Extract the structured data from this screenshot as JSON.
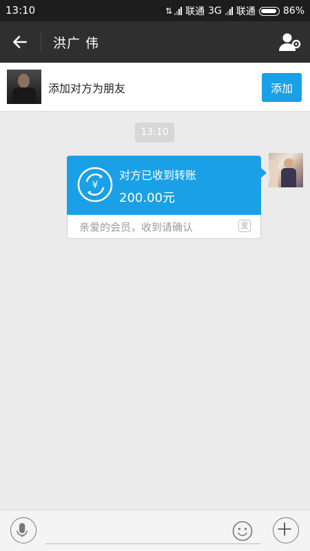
{
  "status_bar": {
    "time": "13:10",
    "carrier1": "联通",
    "network1": "3G",
    "carrier2": "联通",
    "battery": "86%"
  },
  "header": {
    "title": "洪广 伟",
    "back_icon": "arrow-left-icon",
    "settings_icon": "contact-settings-icon"
  },
  "add_friend": {
    "prompt": "添加对方为朋友",
    "button_label": "添加"
  },
  "chat": {
    "timestamp": "13:10",
    "transfer": {
      "title": "对方已收到转账",
      "amount": "200.00元",
      "note": "亲爱的会员，收到请确认",
      "accent_color": "#1aa0e6",
      "icon": "transfer-received-icon",
      "source_icon": "alipay-icon"
    }
  },
  "input_bar": {
    "message_value": "",
    "voice_icon": "microphone-icon",
    "emoji_icon": "smiley-icon",
    "more_icon": "plus-icon"
  }
}
